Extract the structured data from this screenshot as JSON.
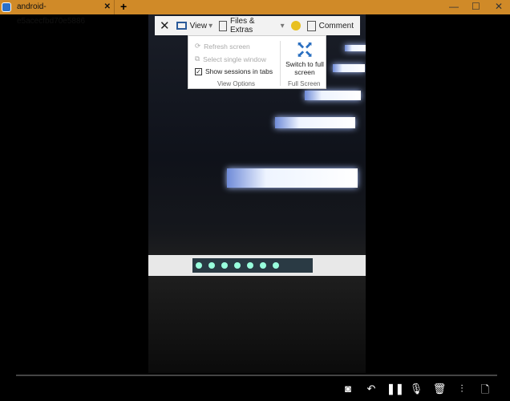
{
  "window": {
    "tab_title": "android-e5acecfbd70e5886",
    "close_tab": "✕",
    "new_tab": "+",
    "minimize": "—",
    "maximize": "☐",
    "close": "✕"
  },
  "toolbar": {
    "close": "✕",
    "view": "View",
    "files_extras": "Files & Extras",
    "comment": "Comment",
    "dropdown_arrow": "▾"
  },
  "view_menu": {
    "refresh": "Refresh screen",
    "select_window": "Select single window",
    "show_tabs": "Show sessions in tabs",
    "show_tabs_checked": true,
    "group_view": "View Options",
    "switch_full": "Switch to full screen",
    "group_full": "Full Screen"
  },
  "controls": [
    "camera-icon",
    "undo-icon",
    "pause-icon",
    "microphone-icon",
    "trash-icon",
    "settings-sliders-icon",
    "export-file-icon"
  ],
  "accent": "#d08a28"
}
